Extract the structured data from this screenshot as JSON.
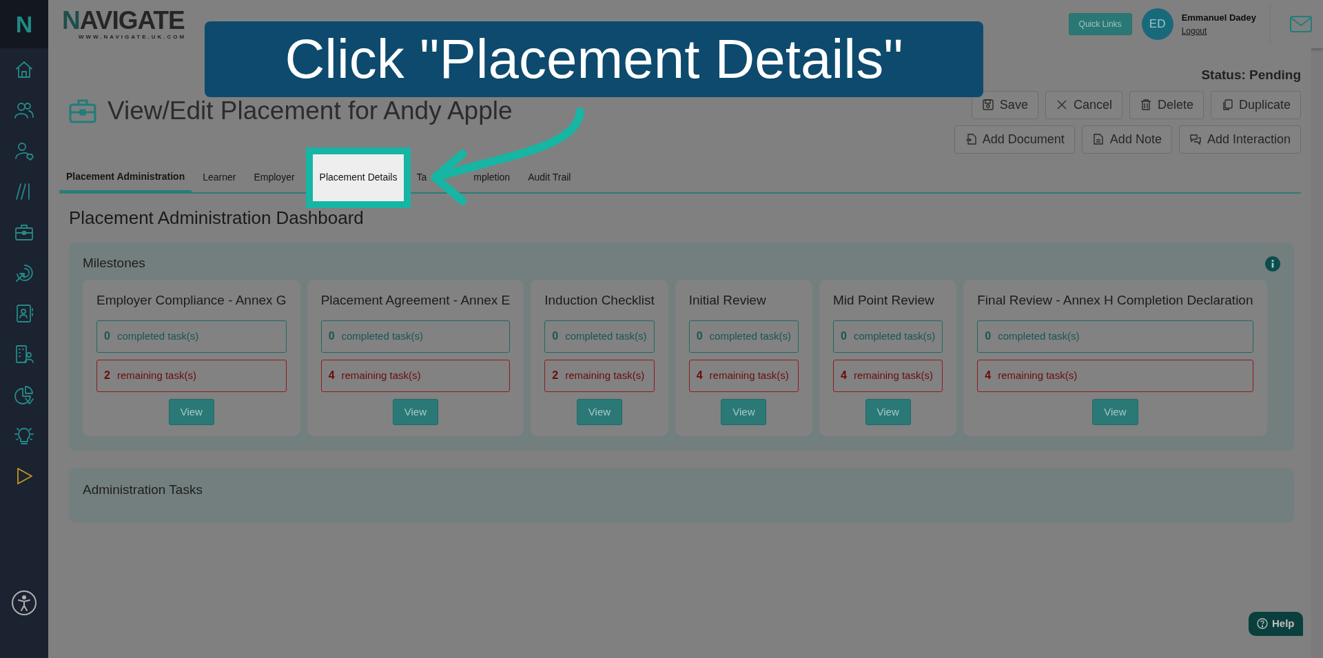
{
  "callout": {
    "text": "Click \"Placement Details\""
  },
  "sidebar": {
    "logo": "N"
  },
  "header": {
    "logo": "NAVIGATE",
    "logo_sub": "WWW.NAVIGATE.UK.COM",
    "quick_links": "Quick Links",
    "user": {
      "initials": "ED",
      "name": "Emmanuel Dadey",
      "logout": "Logout"
    }
  },
  "page": {
    "status": "Status: Pending",
    "title": "View/Edit Placement for Andy Apple",
    "action_rows": [
      {
        "buttons": [
          {
            "kind": "save",
            "label": "Save"
          },
          {
            "kind": "cancel",
            "label": "Cancel"
          },
          {
            "kind": "delete",
            "label": "Delete"
          },
          {
            "kind": "duplicate",
            "label": "Duplicate"
          }
        ]
      },
      {
        "buttons": [
          {
            "kind": "document",
            "label": "Add Document"
          },
          {
            "kind": "note",
            "label": "Add Note"
          },
          {
            "kind": "interaction",
            "label": "Add Interaction"
          }
        ]
      }
    ]
  },
  "tabs": [
    {
      "label": "Placement Administration",
      "selected": true,
      "highlighted": false
    },
    {
      "label": "Learner",
      "selected": false,
      "highlighted": false
    },
    {
      "label": "Employer",
      "selected": false,
      "highlighted": false
    },
    {
      "label": "Placement Details",
      "selected": false,
      "highlighted": true
    },
    {
      "label": "Ta",
      "selected": false,
      "highlighted": false
    },
    {
      "label": "mpletion",
      "selected": false,
      "highlighted": false
    },
    {
      "label": "Audit Trail",
      "selected": false,
      "highlighted": false
    }
  ],
  "dashboard": {
    "title": "Placement Administration Dashboard",
    "milestones": {
      "title": "Milestones",
      "items": [
        {
          "name": "Employer Compliance - Annex G",
          "completed": "0",
          "completed_label": "completed task(s)",
          "remaining": "2",
          "remaining_label": "remaining task(s)",
          "button": "View"
        },
        {
          "name": "Placement Agreement - Annex E",
          "completed": "0",
          "completed_label": "completed task(s)",
          "remaining": "4",
          "remaining_label": "remaining task(s)",
          "button": "View"
        },
        {
          "name": "Induction Checklist",
          "completed": "0",
          "completed_label": "completed task(s)",
          "remaining": "2",
          "remaining_label": "remaining task(s)",
          "button": "View"
        },
        {
          "name": "Initial Review",
          "completed": "0",
          "completed_label": "completed task(s)",
          "remaining": "4",
          "remaining_label": "remaining task(s)",
          "button": "View"
        },
        {
          "name": "Mid Point Review",
          "completed": "0",
          "completed_label": "completed task(s)",
          "remaining": "4",
          "remaining_label": "remaining task(s)",
          "button": "View"
        },
        {
          "name": "Final Review - Annex H Completion Declaration",
          "completed": "0",
          "completed_label": "completed task(s)",
          "remaining": "4",
          "remaining_label": "remaining task(s)",
          "button": "View"
        }
      ]
    },
    "admin_tasks": {
      "title": "Administration Tasks"
    }
  },
  "help": {
    "label": "Help"
  }
}
